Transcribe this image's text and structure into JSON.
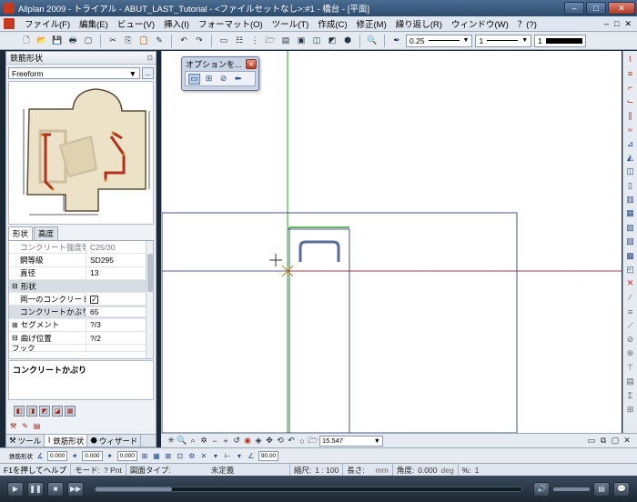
{
  "window": {
    "title": "Allplan 2009 - トライアル - ABUT_LAST_Tutorial - <ファイルセットなし>:#1 - 橋台 - [平面]",
    "minimize_label": "–",
    "maximize_label": "□",
    "close_label": "✕"
  },
  "menu": {
    "items": [
      "ファイル(F)",
      "編集(E)",
      "ビュー(V)",
      "挿入(I)",
      "フォーマット(O)",
      "ツール(T)",
      "作成(C)",
      "修正(M)",
      "繰り返し(R)",
      "ウィンドウ(W)",
      "？(?)"
    ],
    "mdi_min": "–",
    "mdi_max": "□",
    "mdi_close": "✕"
  },
  "toolbar": {
    "pen_value": "0.25",
    "line_value": "1"
  },
  "left_panel": {
    "title": "鉄筋形状",
    "shape_value": "Freeform",
    "more_button_label": "...",
    "tabs": [
      "形状",
      "高度"
    ],
    "properties": [
      {
        "key": "コンクリート強度等級",
        "value": "C25/30",
        "kind": "disabled"
      },
      {
        "key": "鋼等級",
        "value": "SD295",
        "kind": "normal"
      },
      {
        "key": "直径",
        "value": "13",
        "kind": "normal"
      },
      {
        "key": "形状",
        "value": "",
        "kind": "group"
      },
      {
        "key": "両一のコンクリートかぶり",
        "value": "✓",
        "kind": "checkbox"
      },
      {
        "key": "コンクリートかぶり",
        "value": "65",
        "kind": "highlight"
      },
      {
        "key": "セグメント",
        "value": "?/3",
        "kind": "expand"
      },
      {
        "key": "曲げ位置",
        "value": "?/2",
        "kind": "expand"
      },
      {
        "key": "フック",
        "value": "",
        "kind": "partial"
      }
    ],
    "description": "コンクリートかぶり",
    "bottom_tabs": [
      "ツール",
      "鉄筋形状",
      "ウィザード"
    ]
  },
  "options_window": {
    "title": "オプションを..."
  },
  "view_toolbar": {
    "scale_value": "15.547"
  },
  "input_line": {
    "field1_label": "鉄筋形状",
    "field1_value": "0.000",
    "field2_value": "0.000",
    "field3_value": "0.000",
    "field4_value": "90.00"
  },
  "status": {
    "hint": "F1を押してヘルプ",
    "mode_label": "モード:",
    "mode_value": "? Pnt",
    "drawing_type_label": "図面タイプ:",
    "drawing_type_value": "未定義",
    "scale_label": "縮尺:",
    "scale_value": "1 : 100",
    "length_label": "長さ:",
    "length_unit": "mm",
    "angle_label": "角度:",
    "angle_value": "0.000",
    "angle_unit": "deg",
    "percent_label": "%:",
    "percent_value": "1"
  },
  "player": {
    "progress": 0.18
  },
  "colors": {
    "accent": "#c8381f",
    "rebar_blue": "#5a6a9a",
    "axis_green": "#2ca02c",
    "axis_red": "#d02020",
    "cursor_green": "#1aa01a"
  }
}
